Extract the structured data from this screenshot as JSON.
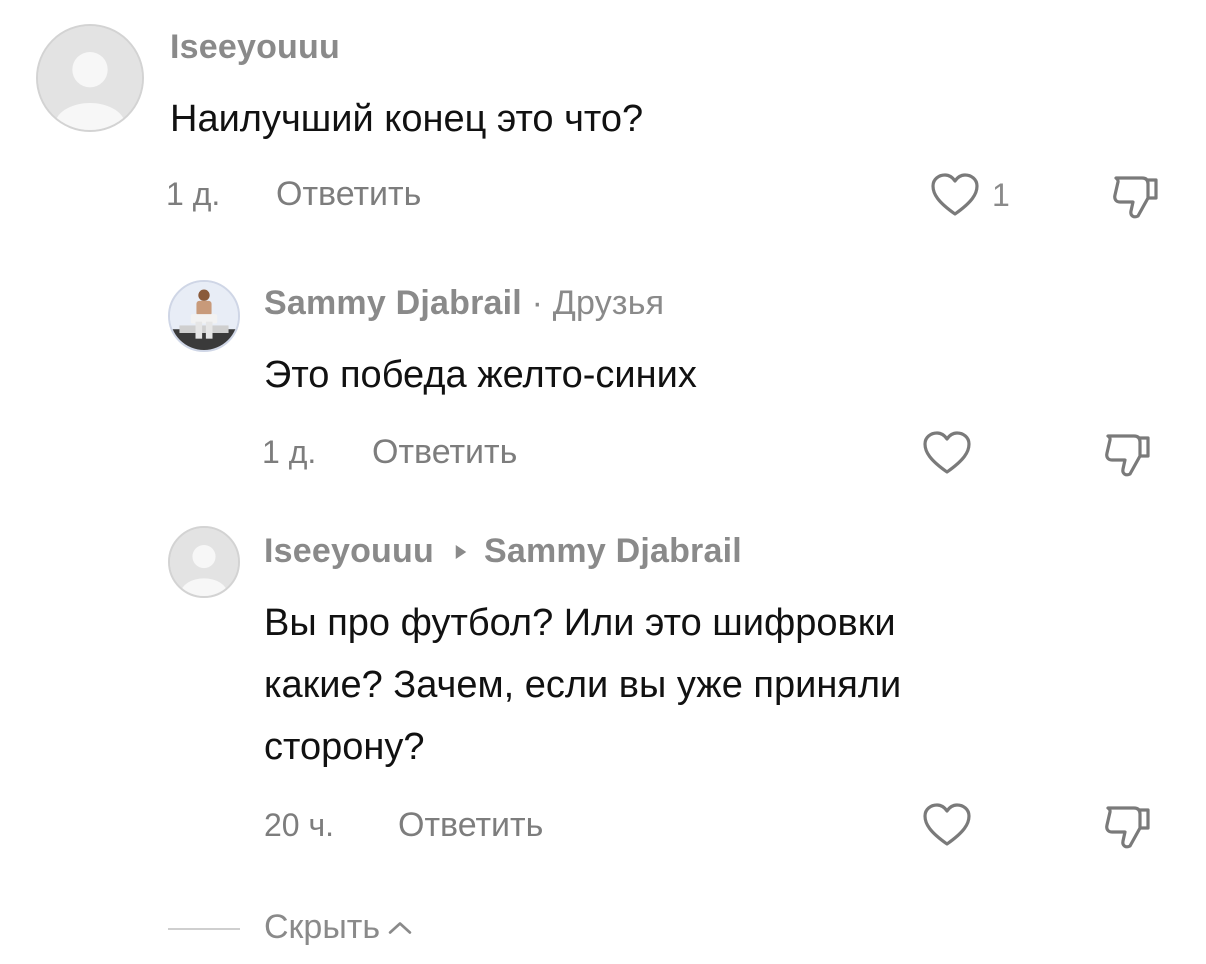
{
  "comments": [
    {
      "author": "Iseeyouuu",
      "text": "Наилучший конец это что?",
      "time": "1 д.",
      "reply_label": "Ответить",
      "likes": "1",
      "avatar_icon": "default-user-icon"
    },
    {
      "author": "Sammy Djabrail",
      "separator": "·",
      "friend_tag": "Друзья",
      "text": "Это победа желто-синих",
      "time": "1 д.",
      "reply_label": "Ответить",
      "avatar_icon": "user-photo-avatar"
    },
    {
      "author": "Iseeyouuu",
      "reply_to": "Sammy Djabrail",
      "text_lines": [
        "Вы про футбол? Или это шифровки",
        "какие? Зачем, если вы уже приняли",
        "сторону?"
      ],
      "time": "20 ч.",
      "reply_label": "Ответить",
      "avatar_icon": "default-user-icon"
    }
  ],
  "hide_replies": {
    "label": "Скрыть",
    "icon": "chevron-up-icon"
  },
  "colors": {
    "muted_text": "#8a8a8a",
    "body_text": "#111111",
    "icon_stroke": "#7a7a7a",
    "avatar_bg": "#e3e3e3"
  }
}
